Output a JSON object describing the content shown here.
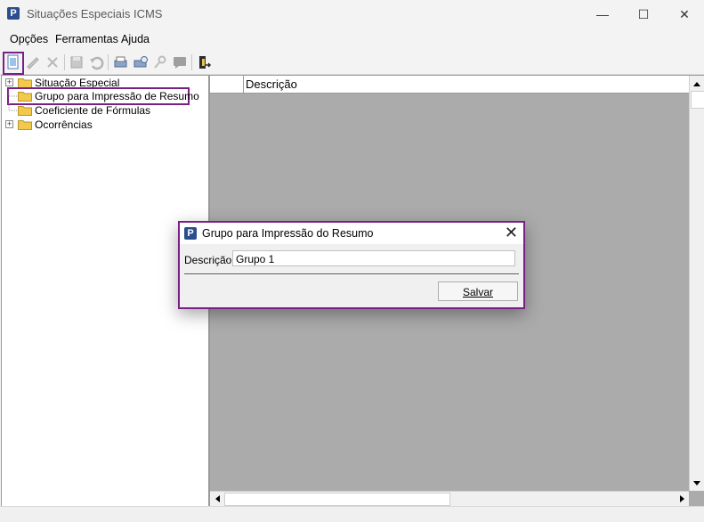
{
  "window": {
    "title": "Situações Especiais ICMS",
    "app_icon_glyph": "P",
    "minimize": "—",
    "maximize": "☐",
    "close": "✕"
  },
  "menu": [
    "Opções",
    "Ferramentas",
    "Ajuda"
  ],
  "toolbar": {
    "icons": [
      "new-document-icon",
      "edit-pencil-icon",
      "delete-x-icon",
      "save-disk-icon",
      "undo-icon",
      "print-icon",
      "print-preview-icon",
      "search-key-icon",
      "comment-icon",
      "exit-door-icon"
    ]
  },
  "tree": {
    "items": [
      {
        "label": "Situação Especial",
        "expandable": true
      },
      {
        "label": "Grupo para Impressão de Resumo",
        "expandable": false,
        "selected": true
      },
      {
        "label": "Coeficiente de Fórmulas",
        "expandable": false
      },
      {
        "label": "Ocorrências",
        "expandable": true
      }
    ]
  },
  "grid": {
    "column": "Descrição"
  },
  "dialog": {
    "title": "Grupo para Impressão do Resumo",
    "app_icon_glyph": "P",
    "field_label": "Descrição:",
    "field_value": "Grupo 1",
    "save_label": "Salvar",
    "close_glyph": "✕"
  },
  "colors": {
    "highlight": "#7a1f86",
    "grid_background": "#ababab",
    "folder": "#f2c94c"
  }
}
